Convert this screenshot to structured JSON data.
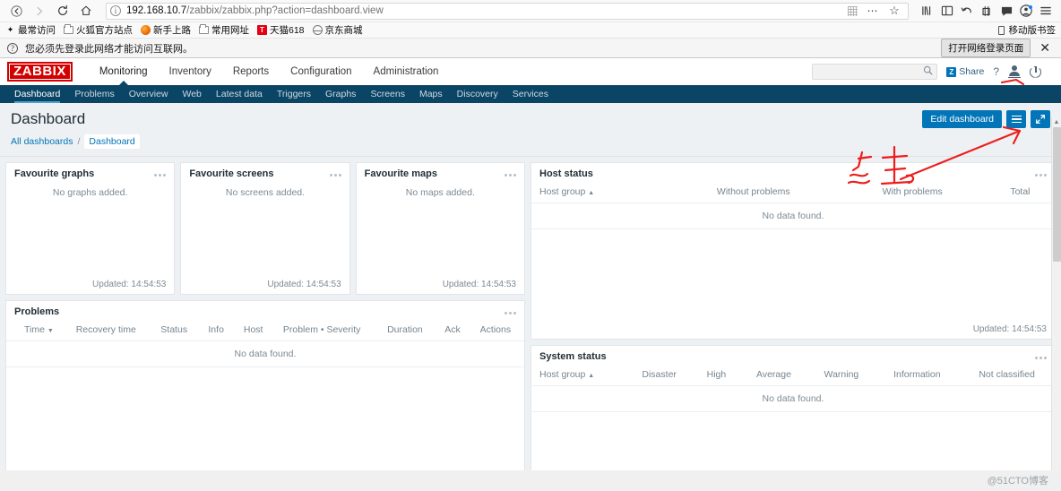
{
  "browser": {
    "nav": {
      "back_icon": "arrow-left-icon",
      "forward_icon": "arrow-right-icon",
      "reload_icon": "reload-icon",
      "home_icon": "home-icon"
    },
    "url": {
      "info_icon": "page-info-icon",
      "host": "192.168.10.7",
      "path": "/zabbix/zabbix.php?action=dashboard.view",
      "grid_icon": "reader-grid-icon",
      "more_icon": "page-actions-icon",
      "bookmark_icon": "star-icon"
    },
    "toolbar_icons": [
      "library-icon",
      "sidebar-icon",
      "undo-icon",
      "screenshot-icon",
      "chat-icon",
      "account-icon",
      "menu-icon"
    ],
    "bookmarks": [
      {
        "label": "最常访问",
        "icon": "star-outline-icon"
      },
      {
        "label": "火狐官方站点",
        "icon": "folder-icon"
      },
      {
        "label": "新手上路",
        "icon": "firefox-icon"
      },
      {
        "label": "常用网址",
        "icon": "folder-icon"
      },
      {
        "label": "天猫618",
        "icon": "tmall-icon"
      },
      {
        "label": "京东商城",
        "icon": "jd-icon"
      }
    ],
    "bookmarks_right": {
      "label": "移动版书签",
      "icon": "phone-icon"
    },
    "notification": {
      "icon": "question-circle-icon",
      "message": "您必须先登录此网络才能访问互联网。",
      "button": "打开网络登录页面",
      "close": "✕"
    }
  },
  "zabbix": {
    "logo": "ZABBIX",
    "main_nav": [
      {
        "label": "Monitoring",
        "active": true
      },
      {
        "label": "Inventory",
        "active": false
      },
      {
        "label": "Reports",
        "active": false
      },
      {
        "label": "Configuration",
        "active": false
      },
      {
        "label": "Administration",
        "active": false
      }
    ],
    "sub_nav": [
      {
        "label": "Dashboard",
        "active": true
      },
      {
        "label": "Problems",
        "active": false
      },
      {
        "label": "Overview",
        "active": false
      },
      {
        "label": "Web",
        "active": false
      },
      {
        "label": "Latest data",
        "active": false
      },
      {
        "label": "Triggers",
        "active": false
      },
      {
        "label": "Graphs",
        "active": false
      },
      {
        "label": "Screens",
        "active": false
      },
      {
        "label": "Maps",
        "active": false
      },
      {
        "label": "Discovery",
        "active": false
      },
      {
        "label": "Services",
        "active": false
      }
    ],
    "search": {
      "value": "",
      "placeholder": "",
      "icon": "search-icon"
    },
    "share": {
      "label": "Share",
      "badge": "Z"
    },
    "help_label": "?",
    "user_icon": "user-profile-icon",
    "signout_icon": "power-signout-icon",
    "page_title": "Dashboard",
    "edit_button": "Edit dashboard",
    "menu_button_icon": "hamburger-icon",
    "fullscreen_button_icon": "expand-icon",
    "breadcrumb": {
      "root": "All dashboards",
      "separator": "/",
      "current": "Dashboard"
    },
    "widgets": {
      "favourite_graphs": {
        "title": "Favourite graphs",
        "empty": "No graphs added.",
        "updated": "Updated: 14:54:53"
      },
      "favourite_screens": {
        "title": "Favourite screens",
        "empty": "No screens added.",
        "updated": "Updated: 14:54:53"
      },
      "favourite_maps": {
        "title": "Favourite maps",
        "empty": "No maps added.",
        "updated": "Updated: 14:54:53"
      },
      "problems": {
        "title": "Problems",
        "columns": [
          "Time",
          "Recovery time",
          "Status",
          "Info",
          "Host",
          "Problem • Severity",
          "Duration",
          "Ack",
          "Actions"
        ],
        "sort_column": "Time",
        "sort_dir": "▼",
        "empty": "No data found."
      },
      "host_status": {
        "title": "Host status",
        "columns": [
          "Host group",
          "Without problems",
          "With problems",
          "Total"
        ],
        "sort_column": "Host group",
        "sort_dir": "▲",
        "empty": "No data found.",
        "updated": "Updated: 14:54:53"
      },
      "system_status": {
        "title": "System status",
        "columns": [
          "Host group",
          "Disaster",
          "High",
          "Average",
          "Warning",
          "Information",
          "Not classified"
        ],
        "sort_column": "Host group",
        "sort_dir": "▲",
        "empty": "No data found."
      }
    }
  },
  "annotation": {
    "type": "red-handwriting",
    "color": "#ee1c1c",
    "description": "手写红色批注与指向用户图标的箭头"
  },
  "watermark": "@51CTO博客",
  "colors": {
    "zabbix_red": "#d40000",
    "zabbix_navy": "#0b4565",
    "zabbix_blue": "#0275b8",
    "annotation_red": "#ee1c1c",
    "page_bg": "#eef1f4"
  }
}
